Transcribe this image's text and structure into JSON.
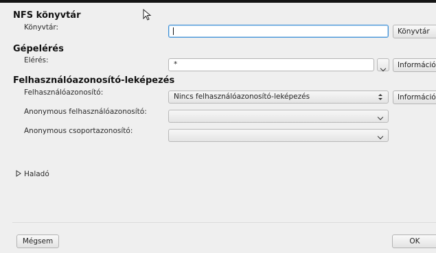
{
  "nfs_section": {
    "heading": "NFS könyvtár",
    "library_label": "Könyvtár:",
    "library_value": "",
    "library_button": "Könyvtár"
  },
  "access_section": {
    "heading": "Gépelérés",
    "access_label": "Elérés:",
    "access_value": "*",
    "info_button": "Információ"
  },
  "mapping_section": {
    "heading": "Felhasználóazonosító-leképezés",
    "uid_label": "Felhasználóazonosító:",
    "uid_selected": "Nincs felhasználóazonosító-leképezés",
    "info_button": "Információ",
    "anon_uid_label": "Anonymous felhasználóazonosító:",
    "anon_uid_selected": "",
    "anon_gid_label": "Anonymous csoportazonosító:",
    "anon_gid_selected": ""
  },
  "advanced": {
    "label": "Haladó"
  },
  "footer": {
    "cancel_label": "Mégsem",
    "ok_label": "OK"
  },
  "colors": {
    "focus_border": "#3d8fd6",
    "background": "#efefef"
  }
}
